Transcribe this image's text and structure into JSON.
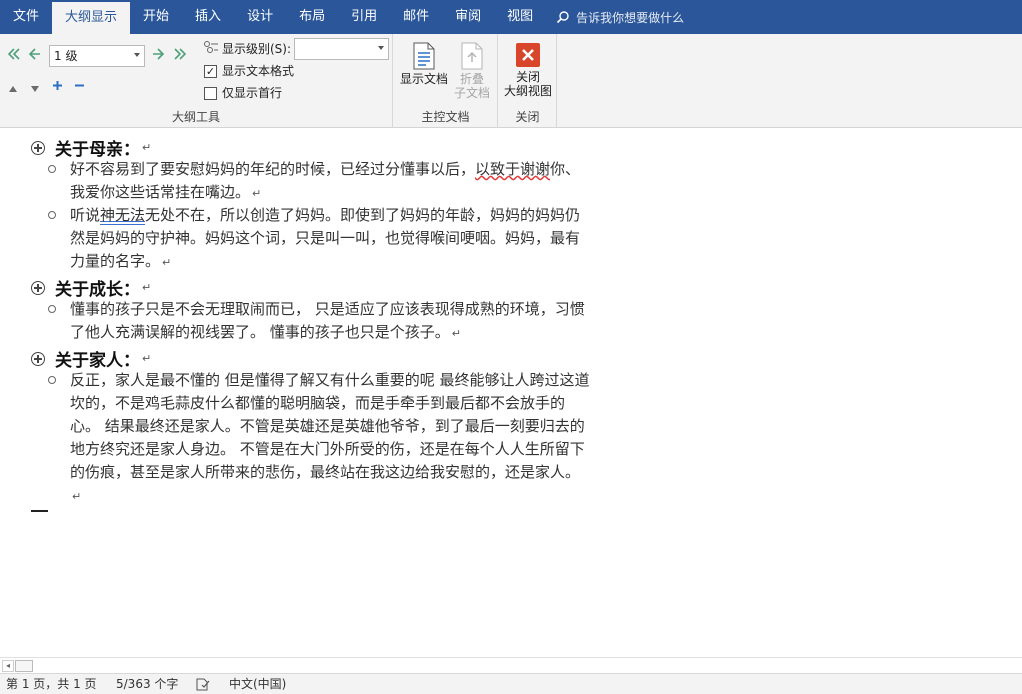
{
  "tabs": [
    {
      "label": "文件",
      "active": false
    },
    {
      "label": "大纲显示",
      "active": true
    },
    {
      "label": "开始",
      "active": false
    },
    {
      "label": "插入",
      "active": false
    },
    {
      "label": "设计",
      "active": false
    },
    {
      "label": "布局",
      "active": false
    },
    {
      "label": "引用",
      "active": false
    },
    {
      "label": "邮件",
      "active": false
    },
    {
      "label": "审阅",
      "active": false
    },
    {
      "label": "视图",
      "active": false
    }
  ],
  "tell_me": "告诉我你想要做什么",
  "ribbon": {
    "outline_tools": {
      "level_value": "1 级",
      "show_level_label": "显示级别(S):",
      "show_level_value": "",
      "show_text_format_label": "显示文本格式",
      "show_text_format_checked": true,
      "show_first_line_label": "仅显示首行",
      "show_first_line_checked": false,
      "group_label": "大纲工具"
    },
    "master_doc": {
      "show_doc_label": "显示文档",
      "collapse_line1": "折叠",
      "collapse_line2": "子文档",
      "group_label": "主控文档"
    },
    "close": {
      "close_line1": "关闭",
      "close_line2": "大纲视图",
      "group_label": "关闭"
    }
  },
  "colors": {
    "accent": "#2b579a",
    "close_red": "#d9452b",
    "disabled": "#a6a6a6"
  },
  "document": {
    "pilcrow": "↵",
    "sections": [
      {
        "heading": "关于母亲：",
        "paragraphs": [
          {
            "pre": "好不容易到了要安慰妈妈的年纪的时候，已经过分懂事以后，",
            "mark": "以致于谢谢",
            "post": "你、我爱你这些话常挂在嘴边。"
          },
          {
            "pre": "听说",
            "mark": "神无法",
            "post": "无处不在，所以创造了妈妈。即使到了妈妈的年龄，妈妈的妈妈仍然是妈妈的守护神。妈妈这个词，只是叫一叫，也觉得喉间哽咽。妈妈，最有力量的名字。"
          }
        ]
      },
      {
        "heading": "关于成长：",
        "paragraphs": [
          {
            "pre": "懂事的孩子只是不会无理取闹而已，  只是适应了应该表现得成熟的环境，习惯了他人充满误解的视线罢了。  懂事的孩子也只是个孩子。",
            "mark": "",
            "post": ""
          }
        ]
      },
      {
        "heading": "关于家人：",
        "paragraphs": [
          {
            "pre": "反正，家人是最不懂的  但是懂得了解又有什么重要的呢  最终能够让人跨过这道坎的，不是鸡毛蒜皮什么都懂的聪明脑袋，而是手牵手到最后都不会放手的心。  结果最终还是家人。不管是英雄还是英雄他爷爷，到了最后一刻要归去的地方终究还是家人身边。  不管是在大门外所受的伤，还是在每个人人生所留下的伤痕，甚至是家人所带来的悲伤，最终站在我这边给我安慰的，还是家人。",
            "mark": "",
            "post": ""
          }
        ]
      }
    ]
  },
  "status": {
    "page": "第 1 页，共 1 页",
    "words": "5/363 个字",
    "language": "中文(中国)"
  }
}
